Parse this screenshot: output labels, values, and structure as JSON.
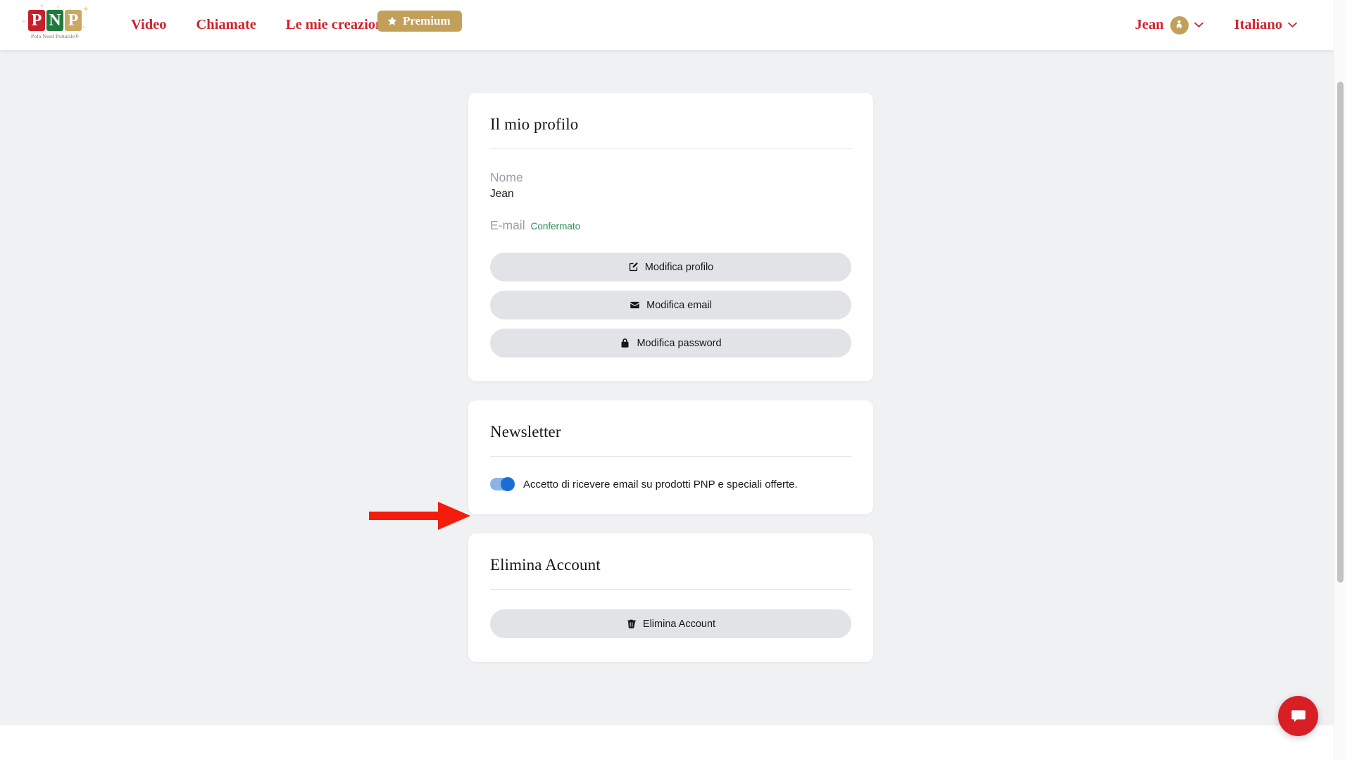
{
  "header": {
    "logo": {
      "tiles": [
        "P",
        "N",
        "P"
      ],
      "tagline": "Polo Nord Portatile®",
      "colors": {
        "red": "#c8202b",
        "green": "#1f7a3d",
        "gold": "#c9a961"
      }
    },
    "nav": [
      {
        "label": "Video",
        "name": "nav-video"
      },
      {
        "label": "Chiamate",
        "name": "nav-chiamate"
      },
      {
        "label": "Le mie creazioni",
        "name": "nav-le-mie-creazioni"
      }
    ],
    "premium": {
      "label": "Premium",
      "icon": "star-icon",
      "color": "#c3a059"
    },
    "account": {
      "label": "Jean",
      "avatar_icon": "user-avatar-icon",
      "chevron": "chevron-down-icon"
    },
    "language": {
      "label": "Italiano",
      "chevron": "chevron-down-icon"
    },
    "link_color": "#d0222b"
  },
  "profile_card": {
    "title": "Il mio profilo",
    "name_label": "Nome",
    "name_value": "Jean",
    "email_label": "E-mail",
    "email_status": "Confermato",
    "email_status_color": "#2f8a52",
    "buttons": [
      {
        "label": "Modifica profilo",
        "icon": "edit-pencil-icon",
        "name": "edit-profile-button"
      },
      {
        "label": "Modifica email",
        "icon": "envelope-icon",
        "name": "edit-email-button"
      },
      {
        "label": "Modifica password",
        "icon": "lock-icon",
        "name": "edit-password-button"
      }
    ]
  },
  "newsletter_card": {
    "title": "Newsletter",
    "toggle_label": "Accetto di ricevere email su prodotti PNP e speciali offerte.",
    "toggle_state": "on",
    "toggle_track_color": "#8ab4e8",
    "toggle_knob_color": "#1a6fd4"
  },
  "delete_card": {
    "title": "Elimina Account",
    "button": {
      "label": "Elimina Account",
      "icon": "trash-icon"
    }
  },
  "chat_widget": {
    "icon": "chat-bubble-icon",
    "color": "#d81f26"
  },
  "annotation": {
    "type": "arrow",
    "direction": "right",
    "color": "#f41c0c",
    "points_to": "newsletter-toggle"
  },
  "page_background": "#f0f1f3"
}
